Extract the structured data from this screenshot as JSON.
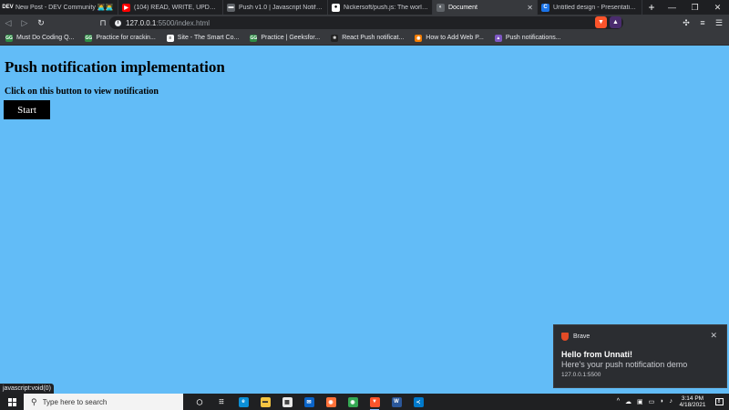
{
  "tabs": [
    {
      "favicon_text": "DEV",
      "favicon_color": "#1e1f22",
      "title": "New Post - DEV Community 👩‍💻👨‍💻",
      "active": false
    },
    {
      "favicon_text": "▶",
      "favicon_color": "#ff0000",
      "title": "(104) READ, WRITE, UPDATE, DELE",
      "active": false
    },
    {
      "favicon_text": "▬",
      "favicon_color": "#5f6368",
      "title": "Push v1.0 | Javascript Notification",
      "active": false
    },
    {
      "favicon_text": "●",
      "favicon_color": "#ffffff",
      "title": "Nickersoft/push.js: The world's m",
      "active": false
    },
    {
      "favicon_text": "◐",
      "favicon_color": "#5f6368",
      "title": "Document",
      "active": true
    },
    {
      "favicon_text": "C",
      "favicon_color": "#1a73e8",
      "title": "Untitled design - Presentation (16:",
      "active": false
    }
  ],
  "new_tab_label": "+",
  "window_controls": {
    "minimize": "—",
    "restore": "❐",
    "close": "✕"
  },
  "address_bar": {
    "host": "127.0.0.1",
    "rest": ":5500/index.html"
  },
  "bookmarks": [
    {
      "label": "Must Do Coding Q...",
      "icon_color": "#2f8d46",
      "icon_text": "GG"
    },
    {
      "label": "Practice for crackin...",
      "icon_color": "#2f8d46",
      "icon_text": "GG"
    },
    {
      "label": "Site - The Smart Co...",
      "icon_color": "#ffffff",
      "icon_text": "≡"
    },
    {
      "label": "Practice | Geeksfor...",
      "icon_color": "#2f8d46",
      "icon_text": "GG"
    },
    {
      "label": "React Push notificat...",
      "icon_color": "#222222",
      "icon_text": "⚛"
    },
    {
      "label": "How to Add Web P...",
      "icon_color": "#f57c00",
      "icon_text": "◉"
    },
    {
      "label": "Push notifications...",
      "icon_color": "#7e57c2",
      "icon_text": "▲"
    }
  ],
  "page": {
    "heading": "Push notification implementation",
    "subheading": "Click on this button to view notification",
    "button_label": "Start"
  },
  "status_bar_text": "javascript:void(0)",
  "notification": {
    "app": "Brave",
    "title": "Hello from Unnati!",
    "body": "Here's your push notification demo",
    "origin": "127.0.0.1:5500",
    "close": "✕"
  },
  "taskbar": {
    "search_placeholder": "Type here to search",
    "apps": [
      {
        "name": "task-view",
        "color": "#1f2022",
        "text": "◯",
        "running": false
      },
      {
        "name": "widgets",
        "color": "#1f2022",
        "text": "☷",
        "running": false
      },
      {
        "name": "edge",
        "color": "#0c8fd6",
        "text": "e",
        "running": false
      },
      {
        "name": "file-explorer",
        "color": "#f4c542",
        "text": "▬",
        "running": false
      },
      {
        "name": "store",
        "color": "#e8e8e8",
        "text": "▦",
        "running": false
      },
      {
        "name": "mail",
        "color": "#0a64c8",
        "text": "✉",
        "running": false
      },
      {
        "name": "firefox",
        "color": "#ff7139",
        "text": "◉",
        "running": false
      },
      {
        "name": "chrome",
        "color": "#34a853",
        "text": "◉",
        "running": false
      },
      {
        "name": "brave",
        "color": "#fb542b",
        "text": "▼",
        "running": true
      },
      {
        "name": "word",
        "color": "#2b579a",
        "text": "W",
        "running": false
      },
      {
        "name": "vscode",
        "color": "#007acc",
        "text": "≺",
        "running": false
      }
    ],
    "tray_icons": [
      "^",
      "☁",
      "▣",
      "▭",
      "◗",
      "♪"
    ],
    "time": "3:14 PM",
    "date": "4/18/2021",
    "notification_count": "8"
  }
}
